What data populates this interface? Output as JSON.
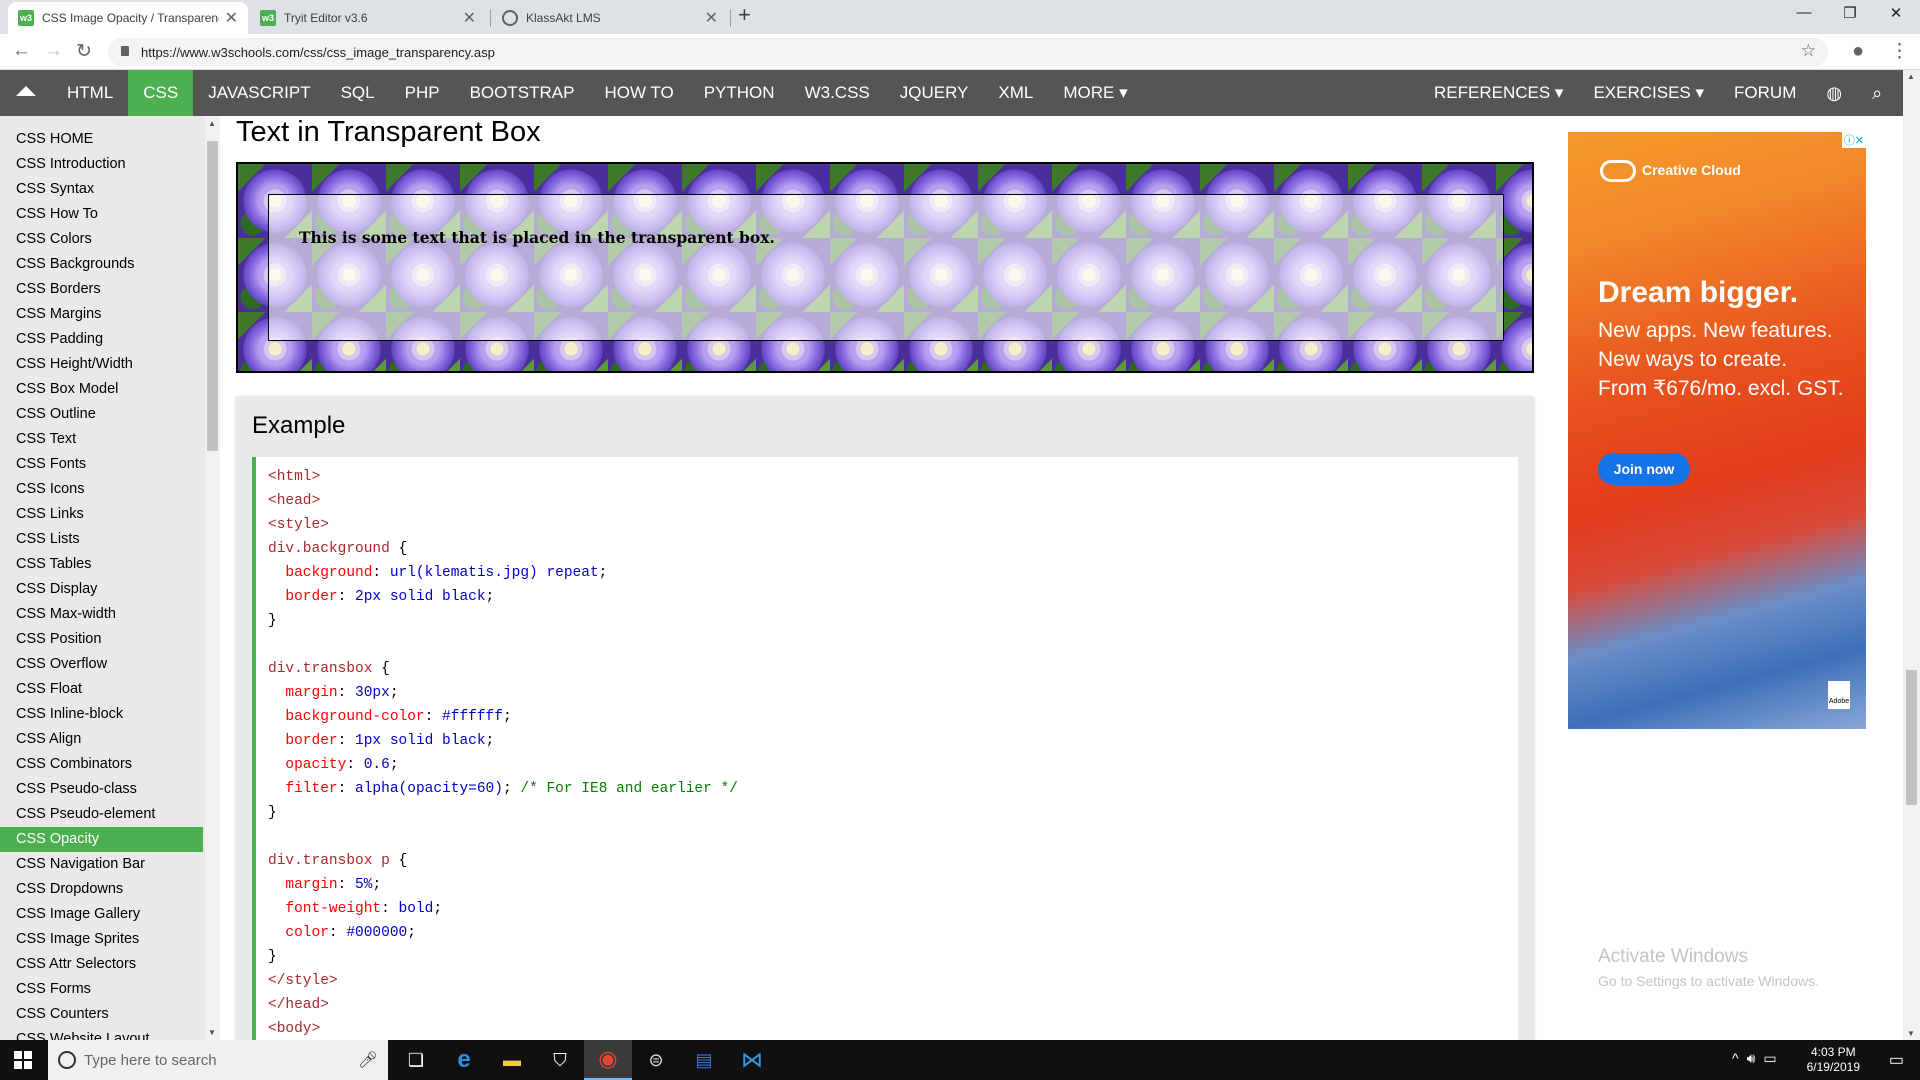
{
  "tabs": [
    {
      "title": "CSS Image Opacity / Transparenc",
      "active": true
    },
    {
      "title": "Tryit Editor v3.6",
      "active": false
    },
    {
      "title": "KlassAkt LMS",
      "active": false
    }
  ],
  "favicon_w3": "w3",
  "address": {
    "url": "https://www.w3schools.com/css/css_image_transparency.asp"
  },
  "navbar": {
    "items": [
      "HTML",
      "CSS",
      "JAVASCRIPT",
      "SQL",
      "PHP",
      "BOOTSTRAP",
      "HOW TO",
      "PYTHON",
      "W3.CSS",
      "JQUERY",
      "XML",
      "MORE ▾"
    ],
    "right": [
      "REFERENCES ▾",
      "EXERCISES ▾",
      "FORUM"
    ],
    "selected": "CSS"
  },
  "sidebar": {
    "items": [
      "CSS HOME",
      "CSS Introduction",
      "CSS Syntax",
      "CSS How To",
      "CSS Colors",
      "CSS Backgrounds",
      "CSS Borders",
      "CSS Margins",
      "CSS Padding",
      "CSS Height/Width",
      "CSS Box Model",
      "CSS Outline",
      "CSS Text",
      "CSS Fonts",
      "CSS Icons",
      "CSS Links",
      "CSS Lists",
      "CSS Tables",
      "CSS Display",
      "CSS Max-width",
      "CSS Position",
      "CSS Overflow",
      "CSS Float",
      "CSS Inline-block",
      "CSS Align",
      "CSS Combinators",
      "CSS Pseudo-class",
      "CSS Pseudo-element",
      "CSS Opacity",
      "CSS Navigation Bar",
      "CSS Dropdowns",
      "CSS Image Gallery",
      "CSS Image Sprites",
      "CSS Attr Selectors",
      "CSS Forms",
      "CSS Counters",
      "CSS Website Layout"
    ],
    "selected": "CSS Opacity"
  },
  "main": {
    "heading": "Text in Transparent Box",
    "demo_text": "This is some text that is placed in the transparent box.",
    "example_heading": "Example",
    "code_lines": [
      [
        {
          "c": "tg",
          "t": "<html>"
        }
      ],
      [
        {
          "c": "tg",
          "t": "<head>"
        }
      ],
      [
        {
          "c": "tg",
          "t": "<style>"
        }
      ],
      [
        {
          "c": "sel2",
          "t": "div.background "
        },
        {
          "c": "bk",
          "t": "{"
        }
      ],
      [
        {
          "c": "pr",
          "t": "  background"
        },
        {
          "c": "bk",
          "t": ": "
        },
        {
          "c": "vl",
          "t": "url(klematis.jpg) repeat"
        },
        {
          "c": "bk",
          "t": ";"
        }
      ],
      [
        {
          "c": "pr",
          "t": "  border"
        },
        {
          "c": "bk",
          "t": ": "
        },
        {
          "c": "vl",
          "t": "2px solid black"
        },
        {
          "c": "bk",
          "t": ";"
        }
      ],
      [
        {
          "c": "bk",
          "t": "}"
        }
      ],
      [
        {
          "c": "bk",
          "t": ""
        }
      ],
      [
        {
          "c": "sel2",
          "t": "div.transbox "
        },
        {
          "c": "bk",
          "t": "{"
        }
      ],
      [
        {
          "c": "pr",
          "t": "  margin"
        },
        {
          "c": "bk",
          "t": ": "
        },
        {
          "c": "vl",
          "t": "30px"
        },
        {
          "c": "bk",
          "t": ";"
        }
      ],
      [
        {
          "c": "pr",
          "t": "  background-color"
        },
        {
          "c": "bk",
          "t": ": "
        },
        {
          "c": "vl",
          "t": "#ffffff"
        },
        {
          "c": "bk",
          "t": ";"
        }
      ],
      [
        {
          "c": "pr",
          "t": "  border"
        },
        {
          "c": "bk",
          "t": ": "
        },
        {
          "c": "vl",
          "t": "1px solid black"
        },
        {
          "c": "bk",
          "t": ";"
        }
      ],
      [
        {
          "c": "pr",
          "t": "  opacity"
        },
        {
          "c": "bk",
          "t": ": "
        },
        {
          "c": "vl",
          "t": "0.6"
        },
        {
          "c": "bk",
          "t": ";"
        }
      ],
      [
        {
          "c": "pr",
          "t": "  filter"
        },
        {
          "c": "bk",
          "t": ": "
        },
        {
          "c": "vl",
          "t": "alpha(opacity=60)"
        },
        {
          "c": "bk",
          "t": "; "
        },
        {
          "c": "cm",
          "t": "/* For IE8 and earlier */"
        }
      ],
      [
        {
          "c": "bk",
          "t": "}"
        }
      ],
      [
        {
          "c": "bk",
          "t": ""
        }
      ],
      [
        {
          "c": "sel2",
          "t": "div.transbox p "
        },
        {
          "c": "bk",
          "t": "{"
        }
      ],
      [
        {
          "c": "pr",
          "t": "  margin"
        },
        {
          "c": "bk",
          "t": ": "
        },
        {
          "c": "vl",
          "t": "5%"
        },
        {
          "c": "bk",
          "t": ";"
        }
      ],
      [
        {
          "c": "pr",
          "t": "  font-weight"
        },
        {
          "c": "bk",
          "t": ": "
        },
        {
          "c": "vl",
          "t": "bold"
        },
        {
          "c": "bk",
          "t": ";"
        }
      ],
      [
        {
          "c": "pr",
          "t": "  color"
        },
        {
          "c": "bk",
          "t": ": "
        },
        {
          "c": "vl",
          "t": "#000000"
        },
        {
          "c": "bk",
          "t": ";"
        }
      ],
      [
        {
          "c": "bk",
          "t": "}"
        }
      ],
      [
        {
          "c": "tg",
          "t": "</style>"
        }
      ],
      [
        {
          "c": "tg",
          "t": "</head>"
        }
      ],
      [
        {
          "c": "tg",
          "t": "<body>"
        }
      ]
    ]
  },
  "ad": {
    "info": "ⓘ✕",
    "brand": "Creative Cloud",
    "headline": "Dream bigger.",
    "body_lines": [
      "New apps. New features.",
      "New ways to create.",
      "From ₹676/mo. excl. GST."
    ],
    "cta": "Join now",
    "adobe": "Adobe"
  },
  "watermark": {
    "line1": "Activate Windows",
    "line2": "Go to Settings to activate Windows."
  },
  "taskbar": {
    "search_placeholder": "Type here to search",
    "time": "4:03 PM",
    "date": "6/19/2019"
  },
  "colors": {
    "accent": "#4caf50",
    "navbar": "#555555",
    "sidebar": "#e7e9eb"
  }
}
